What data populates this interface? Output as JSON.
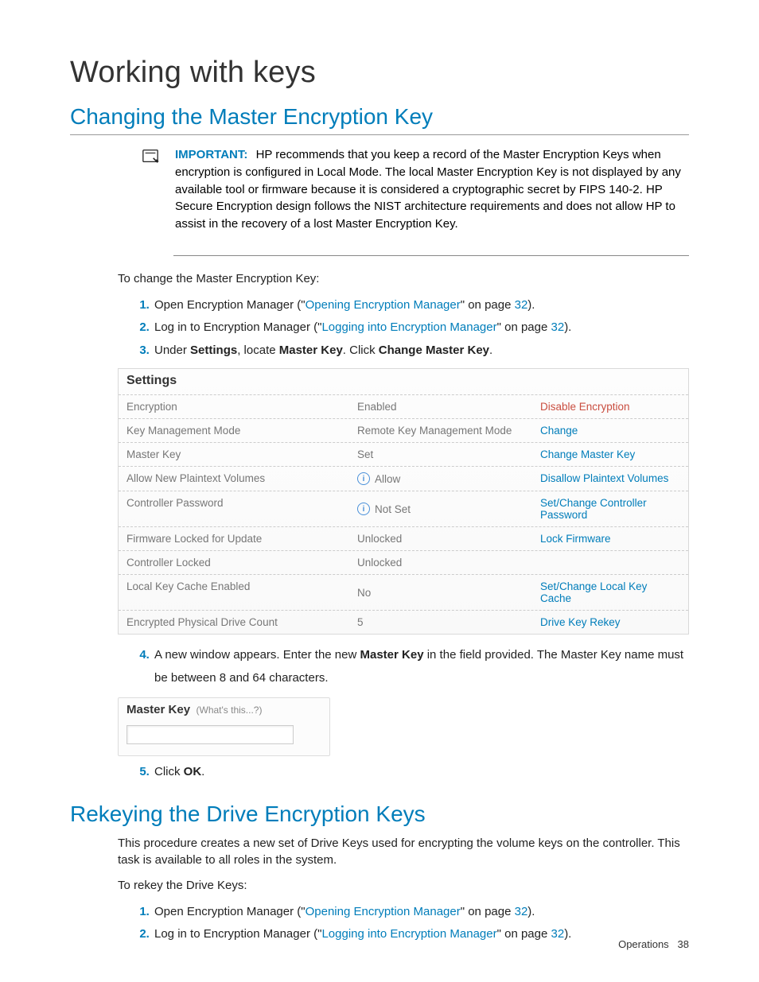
{
  "title": "Working with keys",
  "section1": {
    "heading": "Changing the Master Encryption Key",
    "important_label": "IMPORTANT:",
    "important_text": "HP recommends that you keep a record of the Master Encryption Keys when encryption is configured in Local Mode. The local Master Encryption Key is not displayed by any available tool or firmware because it is considered a cryptographic secret by FIPS 140-2. HP Secure Encryption design follows the NIST architecture requirements and does not allow HP to assist in the recovery of a lost Master Encryption Key.",
    "intro": "To change the Master Encryption Key:",
    "steps": {
      "s1_pre": "Open Encryption Manager (\"",
      "s1_link": "Opening Encryption Manager",
      "s1_post1": "\" on page ",
      "s1_page": "32",
      "s1_post2": ").",
      "s2_pre": "Log in to Encryption Manager (\"",
      "s2_link": "Logging into Encryption Manager",
      "s2_post1": "\" on page ",
      "s2_page": "32",
      "s2_post2": ").",
      "s3_a": "Under ",
      "s3_b": "Settings",
      "s3_c": ", locate ",
      "s3_d": "Master Key",
      "s3_e": ". Click ",
      "s3_f": "Change Master Key",
      "s3_g": ".",
      "s4_a": "A new window appears. Enter the new ",
      "s4_b": "Master Key",
      "s4_c": " in the field provided. The Master Key name must be between 8 and 64 characters.",
      "s5_a": "Click ",
      "s5_b": "OK",
      "s5_c": "."
    }
  },
  "settings": {
    "header": "Settings",
    "rows": [
      {
        "label": "Encryption",
        "value": "Enabled",
        "action": "Disable Encryption",
        "danger": true,
        "info": false
      },
      {
        "label": "Key Management Mode",
        "value": "Remote Key Management Mode",
        "action": "Change",
        "danger": false,
        "info": false
      },
      {
        "label": "Master Key",
        "value": "Set",
        "action": "Change Master Key",
        "danger": false,
        "info": false
      },
      {
        "label": "Allow New Plaintext Volumes",
        "value": "Allow",
        "action": "Disallow Plaintext Volumes",
        "danger": false,
        "info": true
      },
      {
        "label": "Controller Password",
        "value": "Not Set",
        "action": "Set/Change Controller Password",
        "danger": false,
        "info": true
      },
      {
        "label": "Firmware Locked for Update",
        "value": "Unlocked",
        "action": "Lock Firmware",
        "danger": false,
        "info": false
      },
      {
        "label": "Controller Locked",
        "value": "Unlocked",
        "action": "",
        "danger": false,
        "info": false
      },
      {
        "label": "Local Key Cache Enabled",
        "value": "No",
        "action": "Set/Change Local Key Cache",
        "danger": false,
        "info": false
      },
      {
        "label": "Encrypted Physical Drive Count",
        "value": "5",
        "action": "Drive Key Rekey",
        "danger": false,
        "info": false
      }
    ],
    "info_glyph": "i"
  },
  "masterkey": {
    "label": "Master Key",
    "hint": "(What's this...?)",
    "value": ""
  },
  "section2": {
    "heading": "Rekeying the Drive Encryption Keys",
    "p1": "This procedure creates a new set of Drive Keys used for encrypting the volume keys on the controller. This task is available to all roles in the system.",
    "p2": "To rekey the Drive Keys:",
    "steps": {
      "s1_pre": "Open Encryption Manager (\"",
      "s1_link": "Opening Encryption Manager",
      "s1_post1": "\" on page ",
      "s1_page": "32",
      "s1_post2": ").",
      "s2_pre": "Log in to Encryption Manager (\"",
      "s2_link": "Logging into Encryption Manager",
      "s2_post1": "\" on page ",
      "s2_page": "32",
      "s2_post2": ")."
    }
  },
  "footer": {
    "section": "Operations",
    "page": "38"
  }
}
